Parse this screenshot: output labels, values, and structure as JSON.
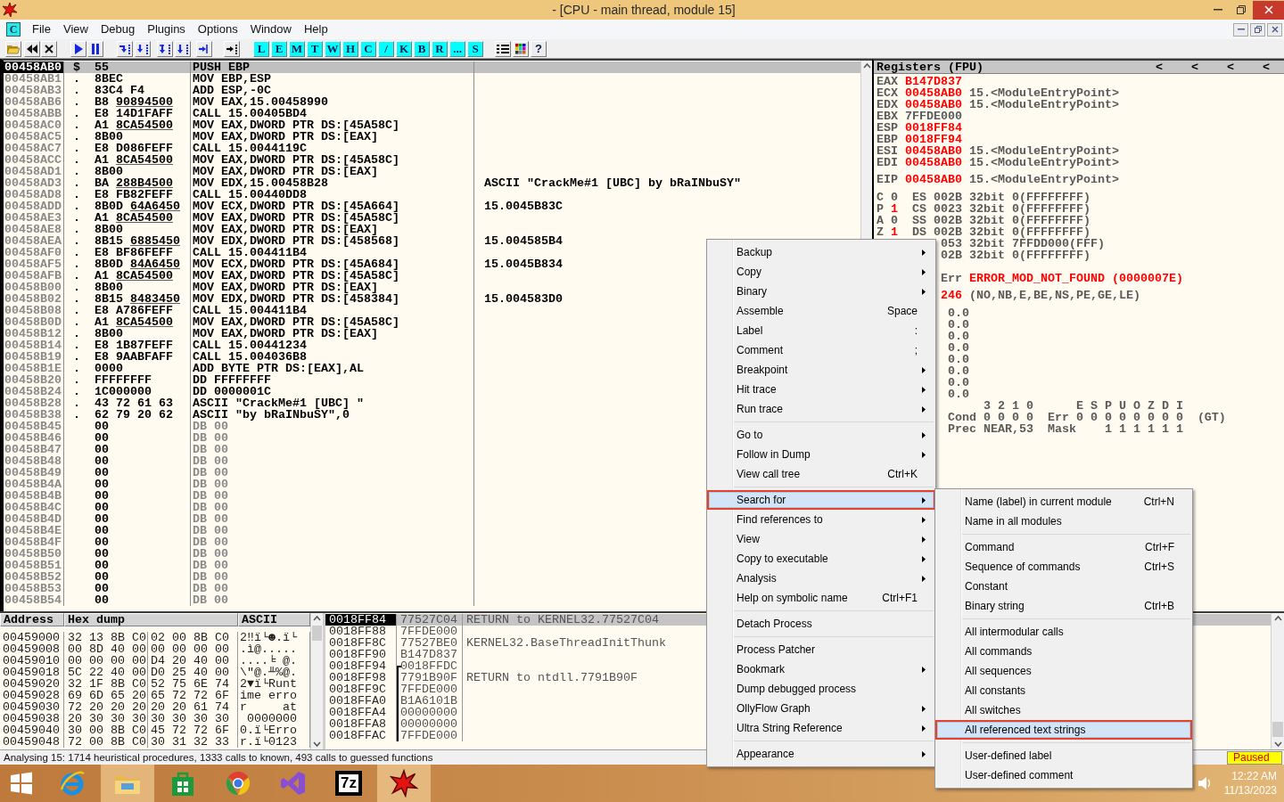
{
  "window": {
    "title": "- [CPU - main thread, module 15]"
  },
  "menu_bar": {
    "child_icon_label": "C",
    "items": [
      "File",
      "View",
      "Debug",
      "Plugins",
      "Options",
      "Window",
      "Help"
    ]
  },
  "toolbar": {
    "letter_buttons": [
      "L",
      "E",
      "M",
      "T",
      "W",
      "H",
      "C",
      "/",
      "K",
      "B",
      "R",
      "...",
      "S"
    ],
    "help_button": "?"
  },
  "disassembly": {
    "rows": [
      {
        "address": "00458AB0",
        "mark": "$",
        "hex": "55",
        "command": "PUSH EBP",
        "kind": "code",
        "selected": true
      },
      {
        "address": "00458AB1",
        "mark": ".",
        "hex": "8BEC",
        "command": "MOV EBP,ESP",
        "kind": "code",
        "selected": false
      },
      {
        "address": "00458AB3",
        "mark": ".",
        "hex": "83C4 F4",
        "command": "ADD ESP,-0C",
        "kind": "code",
        "selected": false
      },
      {
        "address": "00458AB6",
        "mark": ".",
        "hex": "B8",
        "fixup": "90894500",
        "command": "MOV EAX,15.00458990",
        "kind": "code",
        "selected": false
      },
      {
        "address": "00458ABB",
        "mark": ".",
        "hex": "E8 14D1FAFF",
        "command": "CALL 15.00405BD4",
        "kind": "code",
        "selected": false
      },
      {
        "address": "00458AC0",
        "mark": ".",
        "hex": "A1",
        "fixup": "8CA54500",
        "command": "MOV EAX,DWORD PTR DS:[45A58C]",
        "kind": "code",
        "selected": false
      },
      {
        "address": "00458AC5",
        "mark": ".",
        "hex": "8B00",
        "command": "MOV EAX,DWORD PTR DS:[EAX]",
        "kind": "code",
        "selected": false
      },
      {
        "address": "00458AC7",
        "mark": ".",
        "hex": "E8 D086FEFF",
        "command": "CALL 15.0044119C",
        "kind": "code",
        "selected": false
      },
      {
        "address": "00458ACC",
        "mark": ".",
        "hex": "A1",
        "fixup": "8CA54500",
        "command": "MOV EAX,DWORD PTR DS:[45A58C]",
        "kind": "code",
        "selected": false
      },
      {
        "address": "00458AD1",
        "mark": ".",
        "hex": "8B00",
        "command": "MOV EAX,DWORD PTR DS:[EAX]",
        "kind": "code",
        "selected": false
      },
      {
        "address": "00458AD3",
        "mark": ".",
        "hex": "BA",
        "fixup": "288B4500",
        "command": "MOV EDX,15.00458B28",
        "comment": "ASCII \"CrackMe#1 [UBC] by bRaINbuSY\"",
        "kind": "code",
        "selected": false
      },
      {
        "address": "00458AD8",
        "mark": ".",
        "hex": "E8 FB82FEFF",
        "command": "CALL 15.00440DD8",
        "kind": "code",
        "selected": false
      },
      {
        "address": "00458ADD",
        "mark": ".",
        "hex": "8B0D",
        "fixup": "64A6450",
        "command": "MOV ECX,DWORD PTR DS:[45A664]",
        "comment": "15.0045B83C",
        "kind": "code",
        "selected": false
      },
      {
        "address": "00458AE3",
        "mark": ".",
        "hex": "A1",
        "fixup": "8CA54500",
        "command": "MOV EAX,DWORD PTR DS:[45A58C]",
        "kind": "code",
        "selected": false
      },
      {
        "address": "00458AE8",
        "mark": ".",
        "hex": "8B00",
        "command": "MOV EAX,DWORD PTR DS:[EAX]",
        "kind": "code",
        "selected": false
      },
      {
        "address": "00458AEA",
        "mark": ".",
        "hex": "8B15",
        "fixup": "6885450",
        "command": "MOV EDX,DWORD PTR DS:[458568]",
        "comment": "15.004585B4",
        "kind": "code",
        "selected": false
      },
      {
        "address": "00458AF0",
        "mark": ".",
        "hex": "E8 BF86FEFF",
        "command": "CALL 15.004411B4",
        "kind": "code",
        "selected": false
      },
      {
        "address": "00458AF5",
        "mark": ".",
        "hex": "8B0D",
        "fixup": "84A6450",
        "command": "MOV ECX,DWORD PTR DS:[45A684]",
        "comment": "15.0045B834",
        "kind": "code",
        "selected": false
      },
      {
        "address": "00458AFB",
        "mark": ".",
        "hex": "A1",
        "fixup": "8CA54500",
        "command": "MOV EAX,DWORD PTR DS:[45A58C]",
        "kind": "code",
        "selected": false
      },
      {
        "address": "00458B00",
        "mark": ".",
        "hex": "8B00",
        "command": "MOV EAX,DWORD PTR DS:[EAX]",
        "kind": "code",
        "selected": false
      },
      {
        "address": "00458B02",
        "mark": ".",
        "hex": "8B15",
        "fixup": "8483450",
        "command": "MOV EDX,DWORD PTR DS:[458384]",
        "comment": "15.004583D0",
        "kind": "code",
        "selected": false
      },
      {
        "address": "00458B08",
        "mark": ".",
        "hex": "E8 A786FEFF",
        "command": "CALL 15.004411B4",
        "kind": "code",
        "selected": false
      },
      {
        "address": "00458B0D",
        "mark": ".",
        "hex": "A1",
        "fixup": "8CA54500",
        "command": "MOV EAX,DWORD PTR DS:[45A58C]",
        "kind": "code",
        "selected": false
      },
      {
        "address": "00458B12",
        "mark": ".",
        "hex": "8B00",
        "command": "MOV EAX,DWORD PTR DS:[EAX]",
        "kind": "code",
        "selected": false
      },
      {
        "address": "00458B14",
        "mark": ".",
        "hex": "E8 1B87FEFF",
        "command": "CALL 15.00441234",
        "kind": "code",
        "selected": false
      },
      {
        "address": "00458B19",
        "mark": ".",
        "hex": "E8 9AABFAFF",
        "command": "CALL 15.004036B8",
        "kind": "code",
        "selected": false
      },
      {
        "address": "00458B1E",
        "mark": ".",
        "hex": "0000",
        "command": "ADD BYTE PTR DS:[EAX],AL",
        "kind": "code",
        "selected": false
      },
      {
        "address": "00458B20",
        "mark": ".",
        "hex": "FFFFFFFF",
        "command": "DD FFFFFFFF",
        "kind": "code",
        "selected": false
      },
      {
        "address": "00458B24",
        "mark": ".",
        "hex": "1C000000",
        "command": "DD 0000001C",
        "kind": "code",
        "selected": false
      },
      {
        "address": "00458B28",
        "mark": ".",
        "hex": "43 72 61 63",
        "command": "ASCII \"CrackMe#1 [UBC] \"",
        "kind": "code",
        "selected": false
      },
      {
        "address": "00458B38",
        "mark": ".",
        "hex": "62 79 20 62",
        "command": "ASCII \"by bRaINbuSY\",0",
        "kind": "code",
        "selected": false
      },
      {
        "address": "00458B45",
        "hex": "00",
        "command": "DB 00",
        "kind": "padding",
        "selected": false
      },
      {
        "address": "00458B46",
        "hex": "00",
        "command": "DB 00",
        "kind": "padding",
        "selected": false
      },
      {
        "address": "00458B47",
        "hex": "00",
        "command": "DB 00",
        "kind": "padding",
        "selected": false
      },
      {
        "address": "00458B48",
        "hex": "00",
        "command": "DB 00",
        "kind": "padding",
        "selected": false
      },
      {
        "address": "00458B49",
        "hex": "00",
        "command": "DB 00",
        "kind": "padding",
        "selected": false
      },
      {
        "address": "00458B4A",
        "hex": "00",
        "command": "DB 00",
        "kind": "padding",
        "selected": false
      },
      {
        "address": "00458B4B",
        "hex": "00",
        "command": "DB 00",
        "kind": "padding",
        "selected": false
      },
      {
        "address": "00458B4C",
        "hex": "00",
        "command": "DB 00",
        "kind": "padding",
        "selected": false
      },
      {
        "address": "00458B4D",
        "hex": "00",
        "command": "DB 00",
        "kind": "padding",
        "selected": false
      },
      {
        "address": "00458B4E",
        "hex": "00",
        "command": "DB 00",
        "kind": "padding",
        "selected": false
      },
      {
        "address": "00458B4F",
        "hex": "00",
        "command": "DB 00",
        "kind": "padding",
        "selected": false
      },
      {
        "address": "00458B50",
        "hex": "00",
        "command": "DB 00",
        "kind": "padding",
        "selected": false
      },
      {
        "address": "00458B51",
        "hex": "00",
        "command": "DB 00",
        "kind": "padding",
        "selected": false
      },
      {
        "address": "00458B52",
        "hex": "00",
        "command": "DB 00",
        "kind": "padding",
        "selected": false
      },
      {
        "address": "00458B53",
        "hex": "00",
        "command": "DB 00",
        "kind": "padding",
        "selected": false
      },
      {
        "address": "00458B54",
        "hex": "00",
        "command": "DB 00",
        "kind": "padding",
        "selected": false
      }
    ]
  },
  "registers": {
    "title": "Registers (FPU)",
    "header_arrows": [
      "<",
      "<",
      "<",
      "<"
    ],
    "general": [
      {
        "name": "EAX",
        "value": "B147D837",
        "changed": true
      },
      {
        "name": "ECX",
        "value": "00458AB0",
        "changed": true,
        "symbol": "15.<ModuleEntryPoint>"
      },
      {
        "name": "EDX",
        "value": "00458AB0",
        "changed": true,
        "symbol": "15.<ModuleEntryPoint>"
      },
      {
        "name": "EBX",
        "value": "7FFDE000",
        "changed": false
      },
      {
        "name": "ESP",
        "value": "0018FF84",
        "changed": true
      },
      {
        "name": "EBP",
        "value": "0018FF94",
        "changed": true
      },
      {
        "name": "ESI",
        "value": "00458AB0",
        "changed": true,
        "symbol": "15.<ModuleEntryPoint>"
      },
      {
        "name": "EDI",
        "value": "00458AB0",
        "changed": true,
        "symbol": "15.<ModuleEntryPoint>"
      }
    ],
    "eip": {
      "name": "EIP",
      "value": "00458AB0",
      "changed": true,
      "symbol": "15.<ModuleEntryPoint>"
    },
    "segments": [
      {
        "flag": "C",
        "flag_value": "0",
        "changed": false,
        "segment": "ES",
        "selector": "002B",
        "bits": "32bit",
        "base": "0(FFFFFFFF)"
      },
      {
        "flag": "P",
        "flag_value": "1",
        "changed": true,
        "segment": "CS",
        "selector": "0023",
        "bits": "32bit",
        "base": "0(FFFFFFFF)"
      },
      {
        "flag": "A",
        "flag_value": "0",
        "changed": false,
        "segment": "SS",
        "selector": "002B",
        "bits": "32bit",
        "base": "0(FFFFFFFF)"
      },
      {
        "flag": "Z",
        "flag_value": "1",
        "changed": true,
        "segment": "DS",
        "selector": "002B",
        "bits": "32bit",
        "base": "0(FFFFFFFF)"
      },
      {
        "selector": "053",
        "bits": "32bit",
        "base": "7FFDD000(FFF)"
      },
      {
        "selector": "02B",
        "bits": "32bit",
        "base": "0(FFFFFFFF)"
      }
    ],
    "last_error": {
      "label": "Err",
      "value": "ERROR_MOD_NOT_FOUND (0000007E)"
    },
    "flags_register": {
      "value": "246",
      "changed": true,
      "decoded": "(NO,NB,E,BE,NS,PE,GE,LE)"
    },
    "fpu_values": [
      "0.0",
      "0.0",
      "0.0",
      "0.0",
      "0.0",
      "0.0",
      "0.0",
      "0.0"
    ],
    "fpu_status": {
      "cond_header": "3 2 1 0",
      "err_header": "E S P U O Z D I",
      "cond_label": "Cond",
      "cond_bits": "0 0 0 0",
      "err_label": "Err",
      "err_bits": "0 0 0 0 0 0 0 0",
      "compare": "(GT)",
      "prec_label": "Prec",
      "prec": "NEAR,53",
      "mask_label": "Mask",
      "mask_bits": "1 1 1 1 1 1"
    }
  },
  "dump": {
    "columns": [
      "Address",
      "Hex dump",
      "ASCII"
    ],
    "rows": [
      {
        "address": "00459000",
        "hex_1": "32 13 8B C0",
        "hex_2": "02 00 8B C0",
        "ascii": "2‼ï└☻.ï└"
      },
      {
        "address": "00459008",
        "hex_1": "00 8D 40 00",
        "hex_2": "00 00 00 00",
        "ascii": ".ì@....."
      },
      {
        "address": "00459010",
        "hex_1": "00 00 00 00",
        "hex_2": "D4 20 40 00",
        "ascii": "....╘ @."
      },
      {
        "address": "00459018",
        "hex_1": "5C 22 40 00",
        "hex_2": "D0 25 40 00",
        "ascii": "\\\"@.╨%@."
      },
      {
        "address": "00459020",
        "hex_1": "32 1F 8B C0",
        "hex_2": "52 75 6E 74",
        "ascii": "2▼ï└Runt"
      },
      {
        "address": "00459028",
        "hex_1": "69 6D 65 20",
        "hex_2": "65 72 72 6F",
        "ascii": "ime erro"
      },
      {
        "address": "00459030",
        "hex_1": "72 20 20 20",
        "hex_2": "20 20 61 74",
        "ascii": "r     at"
      },
      {
        "address": "00459038",
        "hex_1": "20 30 30 30",
        "hex_2": "30 30 30 30",
        "ascii": " 0000000"
      },
      {
        "address": "00459040",
        "hex_1": "30 00 8B C0",
        "hex_2": "45 72 72 6F",
        "ascii": "0.ï└Erro"
      },
      {
        "address": "00459048",
        "hex_1": "72 00 8B C0",
        "hex_2": "30 31 32 33",
        "ascii": "r.ï└0123"
      }
    ]
  },
  "stack": {
    "rows": [
      {
        "address": "0018FF84",
        "value": "77527C04",
        "comment": "RETURN to KERNEL32.77527C04",
        "selected": true,
        "frame_start": false,
        "frame_line": false
      },
      {
        "address": "0018FF88",
        "value": "7FFDE000",
        "selected": false,
        "frame_start": false,
        "frame_line": false
      },
      {
        "address": "0018FF8C",
        "value": "77527BE0",
        "comment": "KERNEL32.BaseThreadInitThunk",
        "selected": false,
        "frame_start": false,
        "frame_line": false
      },
      {
        "address": "0018FF90",
        "value": "B147D837",
        "selected": false,
        "frame_start": false,
        "frame_line": false
      },
      {
        "address": "0018FF94",
        "value": "0018FFDC",
        "selected": false,
        "frame_start": true,
        "frame_line": false
      },
      {
        "address": "0018FF98",
        "value": "7791B90F",
        "comment": "RETURN to ntdll.7791B90F",
        "selected": false,
        "frame_start": false,
        "frame_line": true
      },
      {
        "address": "0018FF9C",
        "value": "7FFDE000",
        "selected": false,
        "frame_start": false,
        "frame_line": true
      },
      {
        "address": "0018FFA0",
        "value": "B1A6101B",
        "selected": false,
        "frame_start": false,
        "frame_line": true
      },
      {
        "address": "0018FFA4",
        "value": "00000000",
        "selected": false,
        "frame_start": false,
        "frame_line": true
      },
      {
        "address": "0018FFA8",
        "value": "00000000",
        "selected": false,
        "frame_start": false,
        "frame_line": true
      },
      {
        "address": "0018FFAC",
        "value": "7FFDE000",
        "selected": false,
        "frame_start": false,
        "frame_line": true
      }
    ]
  },
  "status_bar": {
    "message": "Analysing 15: 1714 heuristical procedures, 1333 calls to known, 493 calls to guessed functions",
    "state": "Paused"
  },
  "context_menu": {
    "groups": [
      [
        {
          "label": "Backup",
          "submenu": true,
          "selected": false
        },
        {
          "label": "Copy",
          "submenu": true,
          "selected": false
        },
        {
          "label": "Binary",
          "submenu": true,
          "selected": false
        },
        {
          "label": "Assemble",
          "shortcut": "Space",
          "submenu": false,
          "selected": false
        },
        {
          "label": "Label",
          "shortcut": ":",
          "submenu": false,
          "selected": false
        },
        {
          "label": "Comment",
          "shortcut": ";",
          "submenu": false,
          "selected": false
        },
        {
          "label": "Breakpoint",
          "submenu": true,
          "selected": false
        },
        {
          "label": "Hit trace",
          "submenu": true,
          "selected": false
        },
        {
          "label": "Run trace",
          "submenu": true,
          "selected": false
        }
      ],
      [
        {
          "label": "Go to",
          "submenu": true,
          "selected": false
        },
        {
          "label": "Follow in Dump",
          "submenu": true,
          "selected": false
        },
        {
          "label": "View call tree",
          "shortcut": "Ctrl+K",
          "submenu": false,
          "selected": false
        }
      ],
      [
        {
          "label": "Search for",
          "submenu": true,
          "selected": true
        },
        {
          "label": "Find references to",
          "submenu": true,
          "selected": false
        },
        {
          "label": "View",
          "submenu": true,
          "selected": false
        },
        {
          "label": "Copy to executable",
          "submenu": true,
          "selected": false
        },
        {
          "label": "Analysis",
          "submenu": true,
          "selected": false
        },
        {
          "label": "Help on symbolic name",
          "shortcut": "Ctrl+F1",
          "submenu": false,
          "selected": false
        }
      ],
      [
        {
          "label": "Detach Process",
          "submenu": false,
          "selected": false
        }
      ],
      [
        {
          "label": "Process Patcher",
          "submenu": false,
          "selected": false
        },
        {
          "label": "Bookmark",
          "submenu": true,
          "selected": false
        },
        {
          "label": "Dump debugged process",
          "submenu": false,
          "selected": false
        },
        {
          "label": "OllyFlow Graph",
          "submenu": true,
          "selected": false
        },
        {
          "label": "Ultra String Reference",
          "submenu": true,
          "selected": false
        }
      ],
      [
        {
          "label": "Appearance",
          "submenu": true,
          "selected": false
        }
      ]
    ]
  },
  "search_submenu": {
    "groups": [
      [
        {
          "label": "Name (label) in current module",
          "shortcut": "Ctrl+N",
          "submenu": false,
          "selected": false
        },
        {
          "label": "Name in all modules",
          "submenu": false,
          "selected": false
        }
      ],
      [
        {
          "label": "Command",
          "shortcut": "Ctrl+F",
          "submenu": false,
          "selected": false
        },
        {
          "label": "Sequence of commands",
          "shortcut": "Ctrl+S",
          "submenu": false,
          "selected": false
        },
        {
          "label": "Constant",
          "submenu": false,
          "selected": false
        },
        {
          "label": "Binary string",
          "shortcut": "Ctrl+B",
          "submenu": false,
          "selected": false
        }
      ],
      [
        {
          "label": "All intermodular calls",
          "submenu": false,
          "selected": false
        },
        {
          "label": "All commands",
          "submenu": false,
          "selected": false
        },
        {
          "label": "All sequences",
          "submenu": false,
          "selected": false
        },
        {
          "label": "All constants",
          "submenu": false,
          "selected": false
        },
        {
          "label": "All switches",
          "submenu": false,
          "selected": false
        },
        {
          "label": "All referenced text strings",
          "submenu": false,
          "selected": true
        }
      ],
      [
        {
          "label": "User-defined label",
          "submenu": false,
          "selected": false
        },
        {
          "label": "User-defined comment",
          "submenu": false,
          "selected": false
        }
      ]
    ]
  },
  "taskbar": {
    "apps": [
      {
        "kind": "browser_e",
        "active": false
      },
      {
        "kind": "file_manager",
        "active": true
      },
      {
        "kind": "store",
        "active": false
      },
      {
        "kind": "browser_round",
        "active": false
      },
      {
        "kind": "ide",
        "active": false
      },
      {
        "kind": "archiver",
        "label": "7z",
        "active": false
      },
      {
        "kind": "debugger",
        "active": true
      }
    ],
    "clock": {
      "time": "12:22 AM",
      "date": "11/13/2023"
    }
  }
}
